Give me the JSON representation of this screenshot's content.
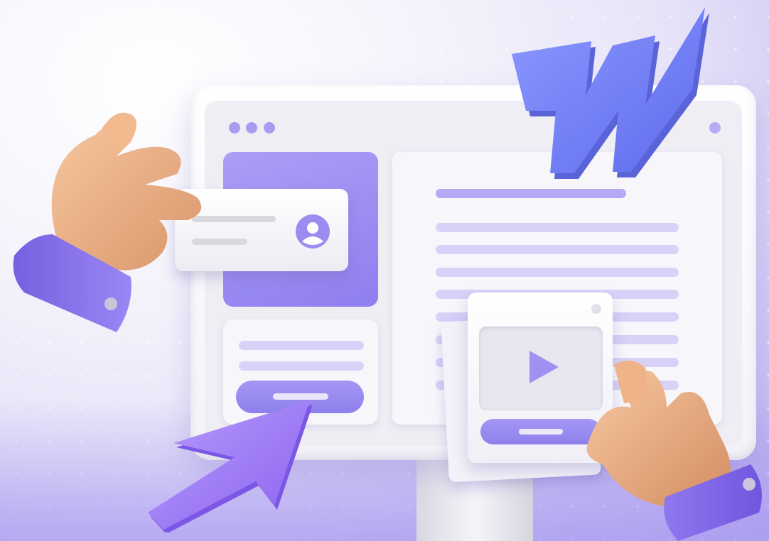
{
  "scene": {
    "monitor": {
      "window_controls": [
        "dot",
        "dot",
        "dot"
      ],
      "left_panel": {
        "icon": "user-avatar-icon"
      },
      "right_panel": {
        "heading_lines": 1,
        "text_lines": 8
      },
      "bottom_card": {
        "lines": 2,
        "button": "pill"
      },
      "video_card": {
        "icon": "play-icon"
      }
    },
    "decorations": {
      "logo": "webflow-w-logo",
      "cursor": "arrow-cursor-icon",
      "hands": [
        "left-hand",
        "right-hand"
      ]
    }
  },
  "colors": {
    "accent": "#9b8df0",
    "accent_light": "#d8d2f8",
    "logo": "#6f7df2",
    "background": "#efeef4"
  }
}
